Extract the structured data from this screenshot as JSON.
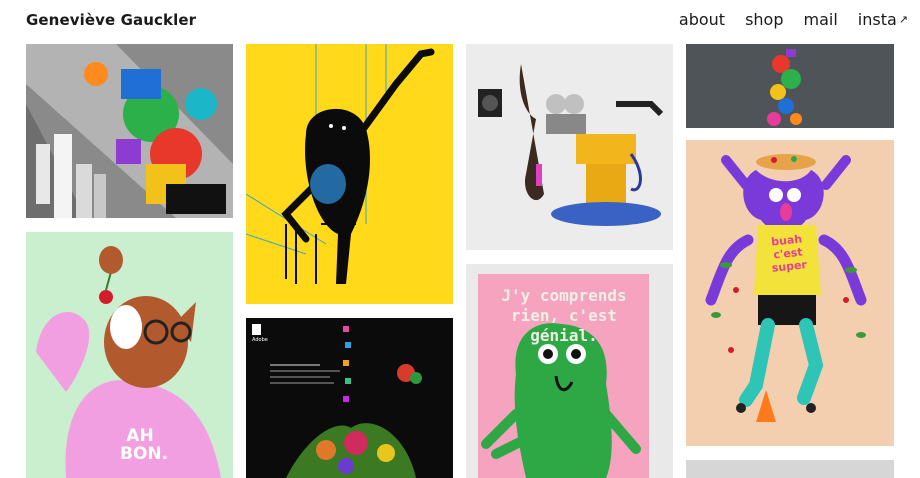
{
  "site": {
    "title": "Geneviève Gauckler"
  },
  "nav": {
    "about": "about",
    "shop": "shop",
    "mail": "mail",
    "insta": "insta",
    "insta_icon": "↗"
  },
  "gallery": {
    "adobe_logo": "Adobe",
    "poster_line1": "J'y comprends",
    "poster_line2": "rien, c'est génial.",
    "fox_shirt_line1": "AH",
    "fox_shirt_line2": "BON.",
    "pizza_shirt": "buah c'est super"
  },
  "colors": {
    "yellow": "#ffd91a",
    "green_bg": "#c9efcf",
    "pink_poster": "#f5a3bf",
    "peach_bg": "#f3cfb0",
    "slate": "#4f5459",
    "grey": "#d6d6d6"
  }
}
